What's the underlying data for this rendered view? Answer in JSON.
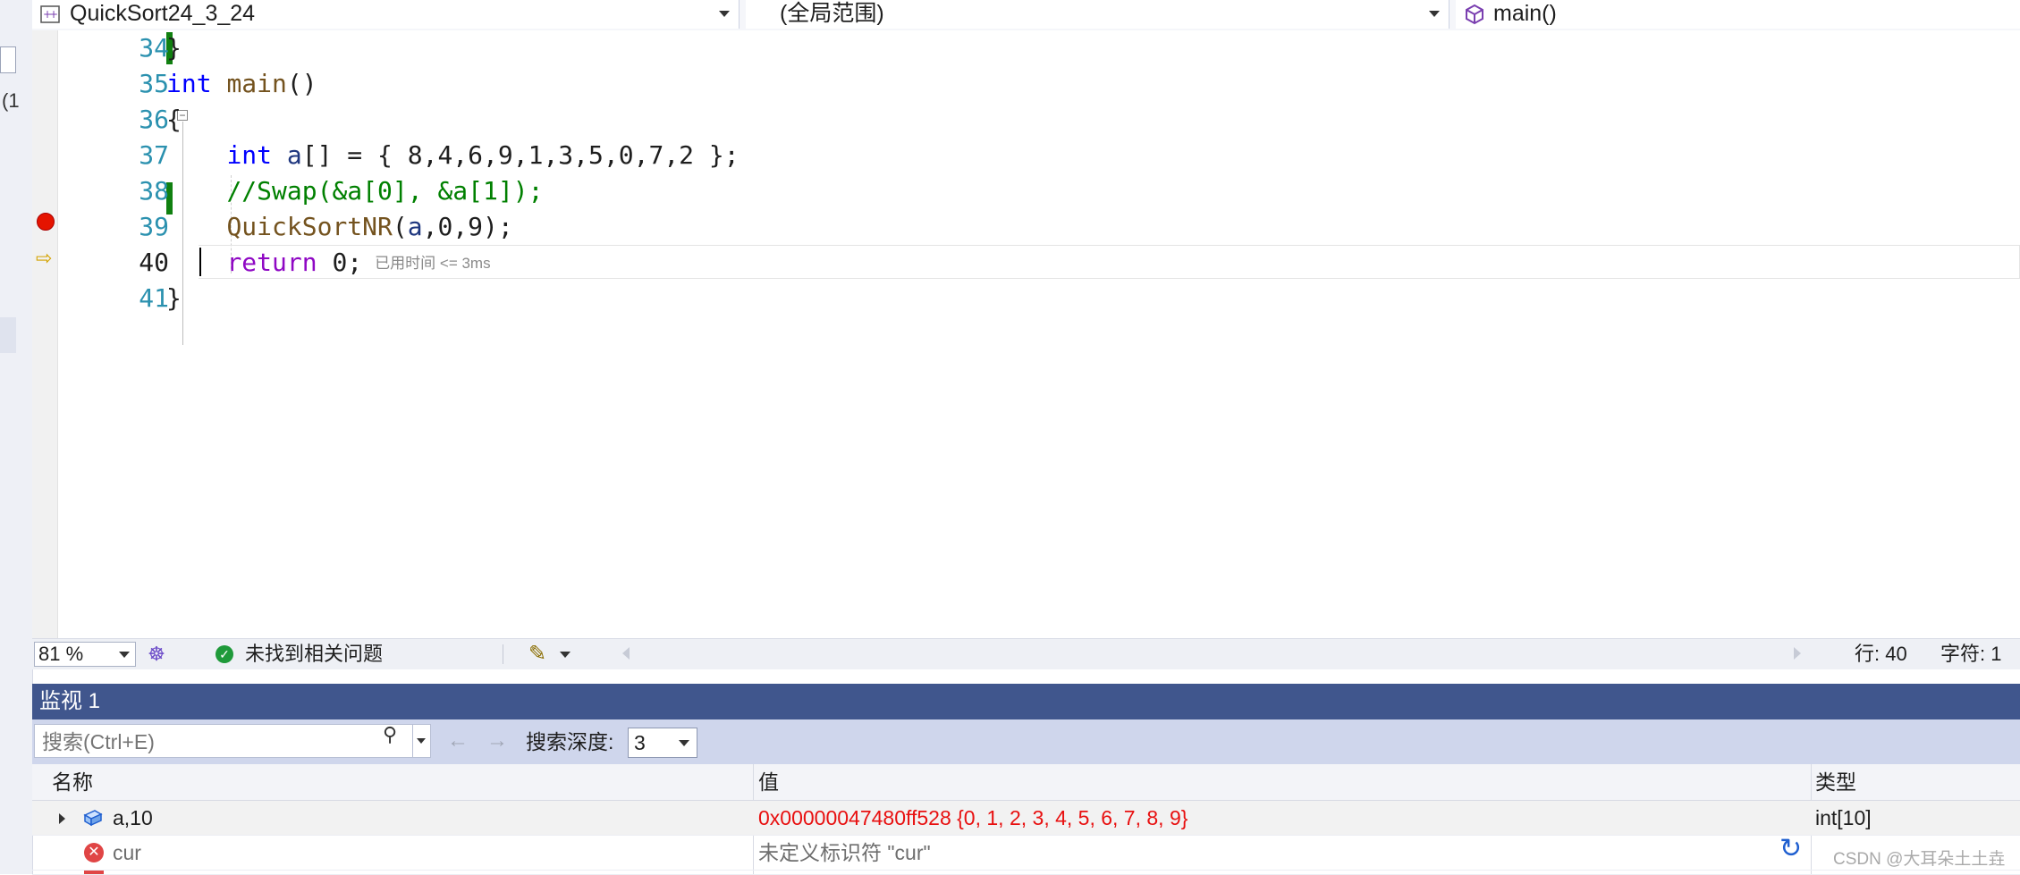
{
  "nav": {
    "project": "QuickSort24_3_24",
    "scope": "(全局范围)",
    "function": "main()"
  },
  "left_strip": {
    "fragment": "(1"
  },
  "editor": {
    "lines": [
      {
        "num": "34",
        "tokens": [
          {
            "t": "}",
            "c": ""
          }
        ]
      },
      {
        "num": "35",
        "tokens": [
          {
            "t": "int",
            "c": "kw"
          },
          {
            "t": " ",
            "c": ""
          },
          {
            "t": "main",
            "c": "fn"
          },
          {
            "t": "()",
            "c": ""
          }
        ]
      },
      {
        "num": "36",
        "tokens": [
          {
            "t": "{",
            "c": ""
          }
        ]
      },
      {
        "num": "37",
        "tokens": [
          {
            "t": "    ",
            "c": ""
          },
          {
            "t": "int",
            "c": "kw"
          },
          {
            "t": " ",
            "c": ""
          },
          {
            "t": "a",
            "c": "var"
          },
          {
            "t": "[] = { 8,4,6,9,1,3,5,0,7,2 };",
            "c": ""
          }
        ]
      },
      {
        "num": "38",
        "tokens": [
          {
            "t": "    ",
            "c": ""
          },
          {
            "t": "//Swap(&a[0], &a[1]);",
            "c": "cmt"
          }
        ]
      },
      {
        "num": "39",
        "tokens": [
          {
            "t": "    ",
            "c": ""
          },
          {
            "t": "QuickSortNR",
            "c": "fn"
          },
          {
            "t": "(",
            "c": ""
          },
          {
            "t": "a",
            "c": "var"
          },
          {
            "t": ",0,9);",
            "c": ""
          }
        ]
      },
      {
        "num": "40",
        "tokens": [
          {
            "t": "    ",
            "c": ""
          },
          {
            "t": "return",
            "c": "kw2"
          },
          {
            "t": " 0;",
            "c": ""
          }
        ],
        "hint": "已用时间 <= 3ms"
      },
      {
        "num": "41",
        "tokens": [
          {
            "t": "}",
            "c": ""
          }
        ]
      }
    ]
  },
  "status": {
    "zoom": "81 %",
    "issues": "未找到相关问题",
    "line": "行: 40",
    "char": "字符: 1"
  },
  "watch": {
    "title": "监视 1",
    "search_placeholder": "搜索(Ctrl+E)",
    "depth_label": "搜索深度:",
    "depth_value": "3",
    "headers": {
      "name": "名称",
      "value": "值",
      "type": "类型"
    },
    "rows": [
      {
        "name": "a,10",
        "value": "0x00000047480ff528 {0, 1, 2, 3, 4, 5, 6, 7, 8, 9}",
        "type": "int[10]"
      },
      {
        "name": "cur",
        "value": "未定义标识符 \"cur\"",
        "type": ""
      }
    ]
  },
  "watermark": "CSDN @大耳朵土土垚",
  "colors": {
    "keyword": "#0000ff",
    "return_keyword": "#8f08c4",
    "function": "#74531f",
    "comment": "#008000",
    "error_value": "#e81010",
    "watch_title_bg": "#40568d"
  }
}
